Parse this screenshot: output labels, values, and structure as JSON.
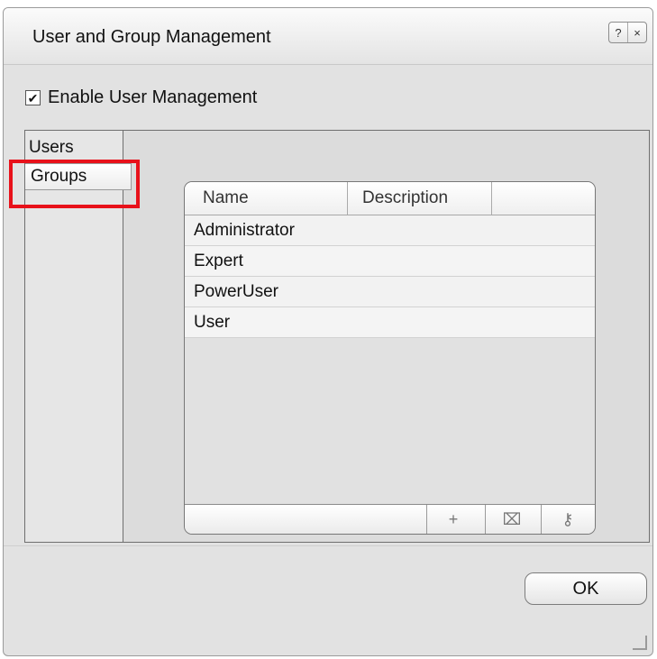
{
  "window": {
    "title": "User and Group Management",
    "help_glyph": "?",
    "close_glyph": "×"
  },
  "enable": {
    "label": "Enable User Management",
    "checked": true,
    "check_glyph": "✔"
  },
  "sidebar": {
    "items": [
      {
        "label": "Users",
        "selected": false
      },
      {
        "label": "Groups",
        "selected": true
      }
    ]
  },
  "table": {
    "columns": [
      "Name",
      "Description",
      ""
    ],
    "rows": [
      "Administrator",
      "Expert",
      "PowerUser",
      "User"
    ],
    "footer_icons": [
      "plus-icon",
      "delete-icon",
      "key-icon"
    ],
    "add_glyph": "+",
    "delete_glyph": "⌧",
    "key_glyph": "⚷"
  },
  "buttons": {
    "ok": "OK"
  },
  "colors": {
    "highlight": "#e8111a"
  }
}
